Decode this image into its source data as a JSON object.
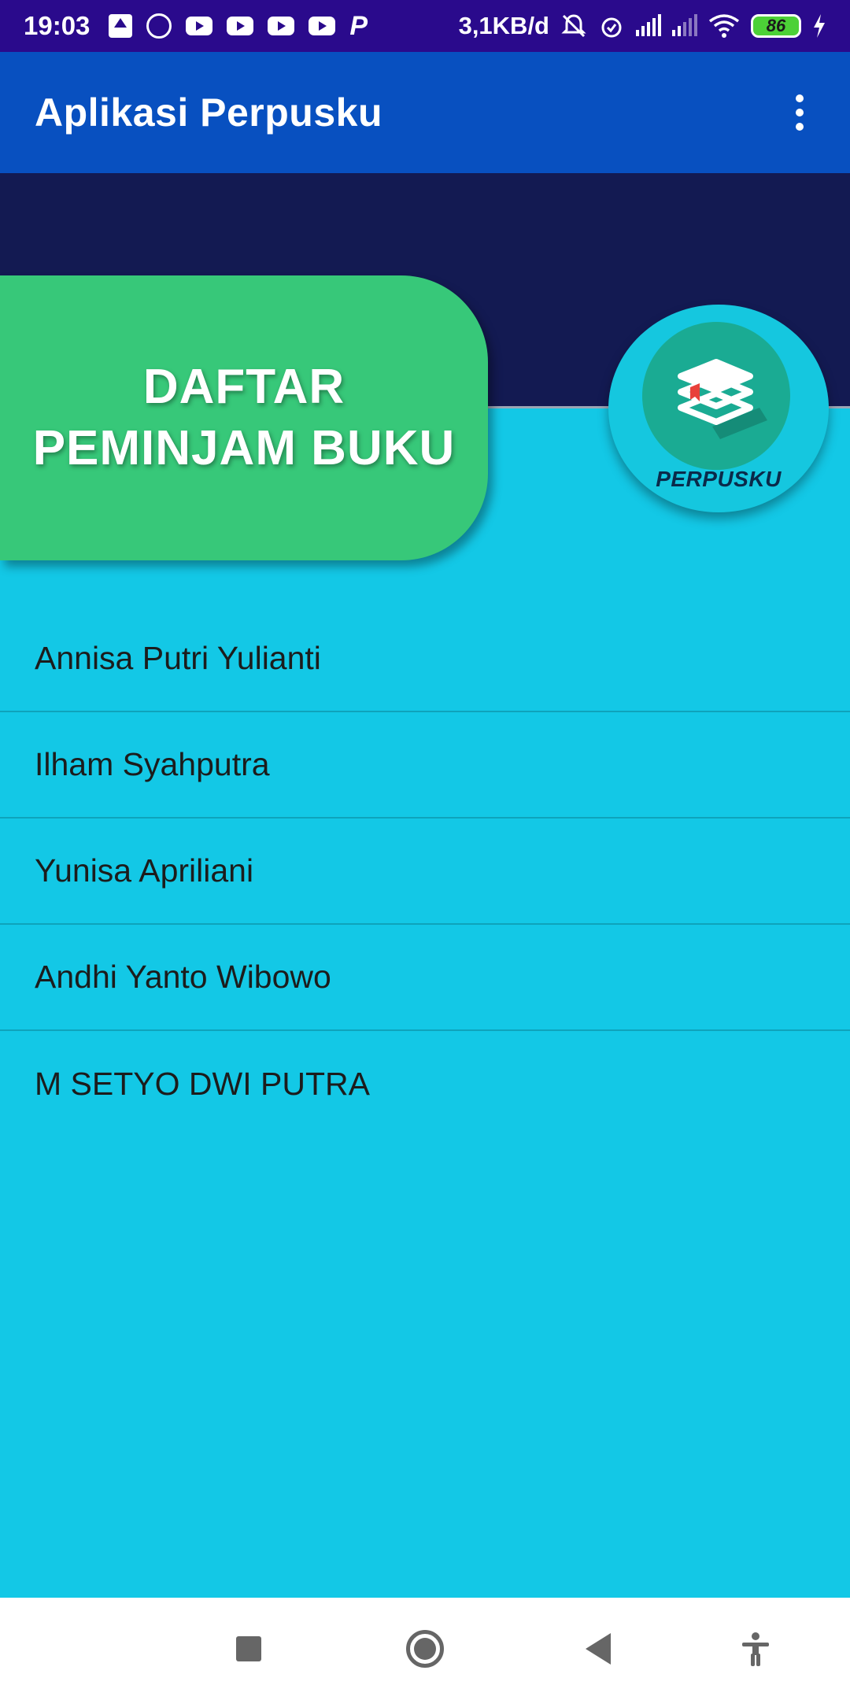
{
  "status_bar": {
    "time": "19:03",
    "data_speed": "3,1KB/d",
    "battery_level": "86",
    "left_icons": [
      "upload-icon",
      "whatsapp-icon",
      "youtube-icon",
      "youtube-icon",
      "youtube-icon",
      "youtube-icon",
      "p-app-icon"
    ],
    "right_icons": [
      "muted-bell-icon",
      "alarm-icon",
      "signal-icon",
      "signal-icon",
      "wifi-icon",
      "battery-icon",
      "charging-icon"
    ]
  },
  "app_bar": {
    "title": "Aplikasi Perpusku",
    "menu_icon": "more-vert-icon"
  },
  "header": {
    "banner_line1": "DAFTAR",
    "banner_line2": "PEMINJAM BUKU",
    "logo_text": "PERPUSKU",
    "logo_icon": "book-stack-icon"
  },
  "borrowers": [
    "Annisa Putri Yulianti",
    "Ilham Syahputra",
    "Yunisa Apriliani",
    "Andhi Yanto Wibowo",
    "M SETYO DWI PUTRA"
  ],
  "nav_bar": {
    "icons": [
      "recents-icon",
      "home-icon",
      "back-icon",
      "accessibility-icon"
    ]
  },
  "colors": {
    "status_bar": "#2a0a8c",
    "app_bar": "#0850c0",
    "header_dark": "#131a52",
    "background": "#13c8e6",
    "banner": "#37c879",
    "logo_inner": "#1aab93"
  }
}
